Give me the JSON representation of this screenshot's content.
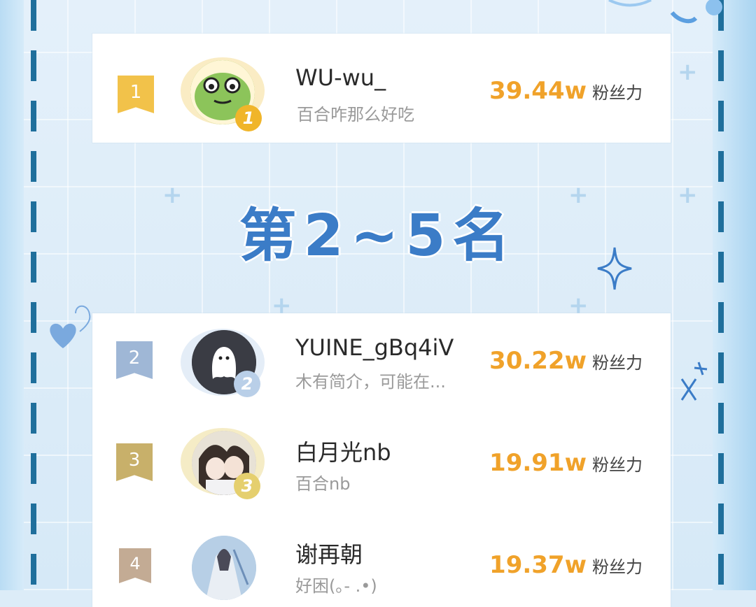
{
  "section_title": "第2~5名",
  "score_unit": "粉丝力",
  "top": {
    "rank": "1",
    "medal": "1",
    "name": "WU-wu_",
    "bio": "百合咋那么好吃",
    "score": "39.44w",
    "avatar_icon": "frog-avatar-icon"
  },
  "rows": [
    {
      "rank": "2",
      "medal": "2",
      "name": "YUINE_gBq4iV",
      "bio": "木有简介，可能在...",
      "score": "30.22w",
      "avatar_icon": "ghost-avatar-icon"
    },
    {
      "rank": "3",
      "medal": "3",
      "name": "白月光nb",
      "bio": "百合nb",
      "score": "19.91w",
      "avatar_icon": "anime-couple-avatar-icon"
    },
    {
      "rank": "4",
      "medal": "",
      "name": "谢再朝",
      "bio": "好困(｡- .•)",
      "score": "19.37w",
      "avatar_icon": "anime-figure-avatar-icon"
    }
  ],
  "colors": {
    "gold": "#f2c24a",
    "silver": "#9fb7d6",
    "bronze": "#c8b06a",
    "fourth": "#c3ab94",
    "score": "#f0a22a",
    "title": "#3b7cc7"
  }
}
